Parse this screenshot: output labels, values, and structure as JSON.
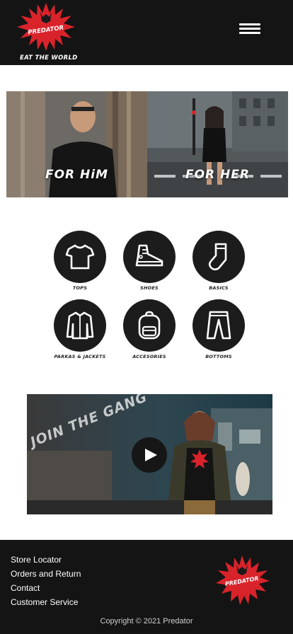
{
  "header": {
    "logo_text": "PREDATOR",
    "tagline": "EAT THE WORLD",
    "logo_icon": "starburst-logo",
    "menu_icon": "hamburger-icon"
  },
  "hero": {
    "cards": [
      {
        "label": "FOR HiM"
      },
      {
        "label": "FOR HER"
      }
    ]
  },
  "categories": {
    "items": [
      {
        "label": "TOPS",
        "icon": "tshirt-icon"
      },
      {
        "label": "SHOES",
        "icon": "sneaker-icon"
      },
      {
        "label": "BASICS",
        "icon": "sock-icon"
      },
      {
        "label": "PARKAS & JACKETS",
        "icon": "jacket-icon"
      },
      {
        "label": "ACCESORIES",
        "icon": "backpack-icon"
      },
      {
        "label": "BOTTOMS",
        "icon": "pants-icon"
      }
    ]
  },
  "video": {
    "caption": "JOIN THE GANG",
    "play_icon": "play-icon"
  },
  "footer": {
    "links": [
      "Store Locator",
      "Orders and Return",
      "Contact",
      "Customer Service"
    ],
    "logo_text": "PREDATOR",
    "copyright": "Copyright © 2021 Predator"
  },
  "colors": {
    "header_bg": "#141414",
    "brand_red": "#d9232b",
    "circle_bg": "#1c1c1c"
  }
}
